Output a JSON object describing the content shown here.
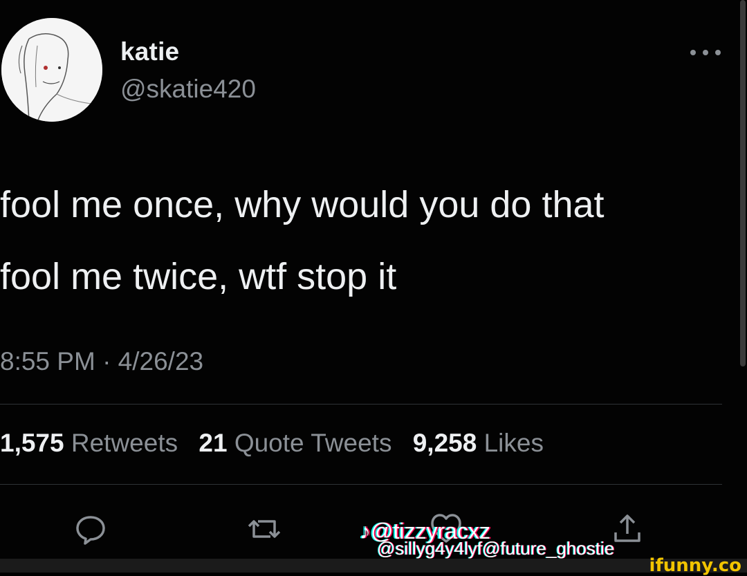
{
  "author": {
    "display_name": "katie",
    "handle": "@skatie420"
  },
  "tweet": {
    "lines": [
      "fool me once, why would you do that",
      "fool me twice, wtf stop it"
    ],
    "timestamp": "8:55 PM · 4/26/23"
  },
  "stats": {
    "retweets_count": "1,575",
    "retweets_label": "Retweets",
    "quotes_count": "21",
    "quotes_label": "Quote Tweets",
    "likes_count": "9,258",
    "likes_label": "Likes"
  },
  "actions": [
    {
      "icon": "reply-icon"
    },
    {
      "icon": "retweet-icon"
    },
    {
      "icon": "like-icon"
    },
    {
      "icon": "share-icon"
    }
  ],
  "watermarks": {
    "tiktok_line1": "@tizzyracxz",
    "tiktok_line2": "@sillyg4y4lyf@future_ghostie",
    "ifunny": "ifunny.co"
  },
  "colors": {
    "background": "#030303",
    "primary_text": "#eef0f2",
    "secondary_text": "#8b9096",
    "divider": "#2f3336",
    "ifunny_brand": "#f2c400"
  }
}
